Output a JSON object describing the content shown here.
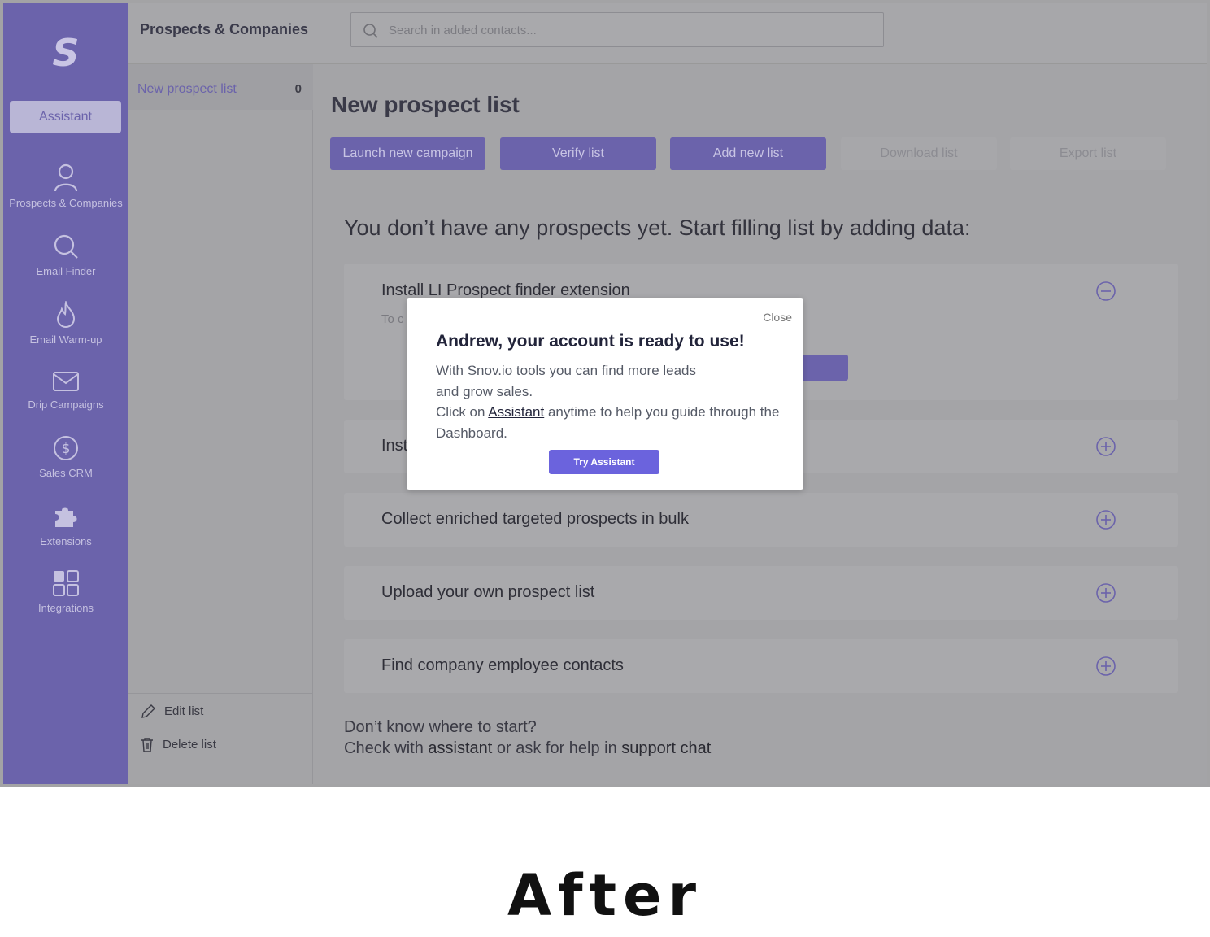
{
  "sidebar": {
    "logo": "S",
    "assistant_label": "Assistant",
    "items": [
      {
        "label": "Prospects & Companies",
        "icon": "user-icon"
      },
      {
        "label": "Email Finder",
        "icon": "search-icon"
      },
      {
        "label": "Email Warm-up",
        "icon": "flame-icon"
      },
      {
        "label": "Drip Campaigns",
        "icon": "envelope-icon"
      },
      {
        "label": "Sales CRM",
        "icon": "dollar-icon"
      },
      {
        "label": "Extensions",
        "icon": "puzzle-icon"
      },
      {
        "label": "Integrations",
        "icon": "grid-icon"
      }
    ]
  },
  "header": {
    "title": "Prospects & Companies",
    "search_placeholder": "Search in added contacts..."
  },
  "lists": {
    "active_name": "New prospect list",
    "active_count": "0",
    "edit_label": "Edit list",
    "delete_label": "Delete list"
  },
  "main": {
    "title": "New prospect list",
    "buttons": {
      "launch": "Launch new campaign",
      "verify": "Verify list",
      "add": "Add new list",
      "download": "Download  list",
      "export": "Export  list"
    },
    "empty_heading": "You don’t have any prospects yet. Start filling list by adding data:",
    "cards": [
      {
        "title": "Install LI Prospect finder extension",
        "sub": "To c",
        "expanded": true
      },
      {
        "title": "Inst",
        "expanded": false
      },
      {
        "title": "Collect enriched targeted prospects in bulk",
        "expanded": false
      },
      {
        "title": "Upload your own prospect list",
        "expanded": false
      },
      {
        "title": "Find company employee contacts",
        "expanded": false
      }
    ],
    "footer_line1": "Don’t know where to start?",
    "footer_prefix": "Check with ",
    "footer_assistant": "assistant",
    "footer_middle": " or ask for help in ",
    "footer_support": "support chat"
  },
  "modal": {
    "close": "Close",
    "title": "Andrew, your account is ready to use!",
    "line1": "With Snov.io  tools you can find more leads",
    "line2": "and grow sales.",
    "line3_prefix": "Click on ",
    "line3_link": "Assistant",
    "line3_suffix": " anytime to help you guide through the",
    "line4": "Dashboard.",
    "button": "Try Assistant"
  },
  "caption": "After",
  "colors": {
    "brand": "#6b63ab",
    "modal_button": "#6b63dd",
    "overlay": "#a4a4a7"
  }
}
